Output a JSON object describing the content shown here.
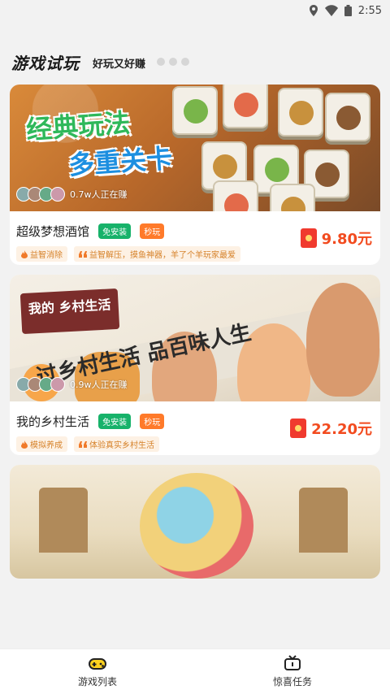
{
  "status_bar": {
    "time": "2:55"
  },
  "header": {
    "title": "游戏试玩",
    "subtitle": "好玩又好赚"
  },
  "games": [
    {
      "banner_line1": "经典玩法",
      "banner_line2": "多重关卡",
      "players": "0.7w人正在赚",
      "name": "超级梦想酒馆",
      "badge1": "免安装",
      "badge2": "秒玩",
      "tag1": "益智消除",
      "tag2": "益智解压，摸鱼神器，羊了个羊玩家最爱",
      "reward": "9.80元"
    },
    {
      "banner_tag": "我的 乡村生活",
      "banner_line1": "过乡村生活 品百味人生",
      "players": "0.9w人正在赚",
      "name": "我的乡村生活",
      "badge1": "免安装",
      "badge2": "秒玩",
      "tag1": "模拟养成",
      "tag2": "体验真实乡村生活",
      "reward": "22.20元"
    }
  ],
  "bottom_nav": [
    {
      "label": "游戏列表",
      "icon": "gamepad-icon",
      "active": true
    },
    {
      "label": "惊喜任务",
      "icon": "tv-icon",
      "active": false
    }
  ],
  "colors": {
    "accent": "#ffd21f",
    "reward": "#f24b1f",
    "badge_green": "#17b26a",
    "badge_orange": "#ff7a2a"
  }
}
